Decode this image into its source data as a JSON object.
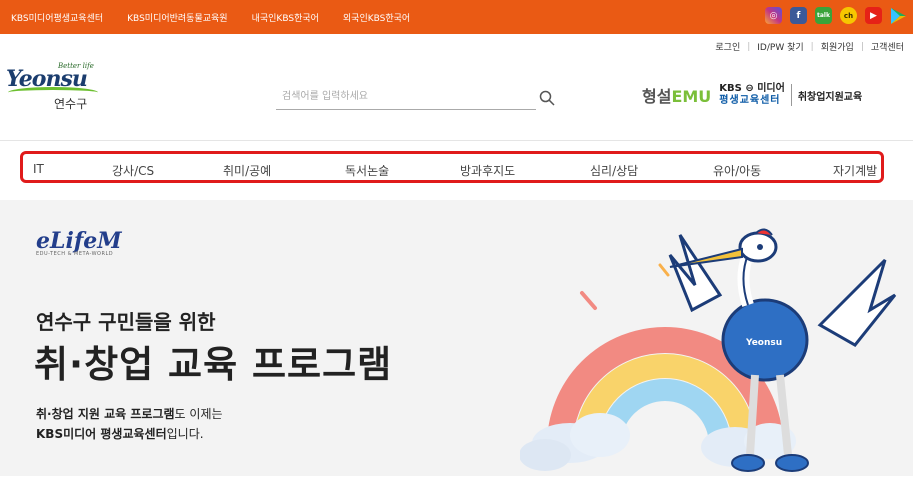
{
  "topbar": {
    "links": [
      "KBS미디어평생교육센터",
      "KBS미디어반려동물교육원",
      "내국인KBS한국어",
      "외국인KBS한국어"
    ],
    "sns": [
      {
        "icon": "instagram-icon",
        "color": "#c13584",
        "glyph": "◎"
      },
      {
        "icon": "facebook-icon",
        "color": "#3b5998",
        "glyph": "f"
      },
      {
        "icon": "kakaotalk-icon",
        "color": "#3aa33a",
        "glyph": "talk"
      },
      {
        "icon": "kakao-channel-icon",
        "color": "#f7c600",
        "glyph": "ch"
      },
      {
        "icon": "youtube-icon",
        "color": "#e62117",
        "glyph": "▶"
      },
      {
        "icon": "play-store-icon",
        "color": "#1fae5b",
        "glyph": "▶"
      }
    ]
  },
  "util": [
    "로그인",
    "ID/PW 찾기",
    "회원가입",
    "고객센터"
  ],
  "logo": {
    "better": "Better life",
    "word": "Yeonsu",
    "kr": "연수구"
  },
  "search": {
    "placeholder": "검색어를 입력하세요"
  },
  "partner": {
    "name1a": "형설",
    "name1b": "EMU",
    "kbs": "KBS ⊖ 미디어",
    "center": "평생교육센터",
    "program": "취창업지원교육"
  },
  "gnb": [
    "IT",
    "강사/CS",
    "취미/공예",
    "독서논술",
    "방과후지도",
    "심리/상담",
    "유아/아동",
    "자기계발"
  ],
  "hero": {
    "brand": "eLifeM",
    "brand_sub": "EDU-TECH & META-WORLD",
    "line1": "연수구 구민들을 위한",
    "line2": "취·창업 교육 프로그램",
    "desc_b1": "취·창업 지원 교육 프로그램",
    "desc_t1": "도 이제는",
    "desc_b2": "KBS미디어 평생교육센터",
    "desc_t2": "입니다.",
    "mascot_label": "Yeonsu"
  }
}
